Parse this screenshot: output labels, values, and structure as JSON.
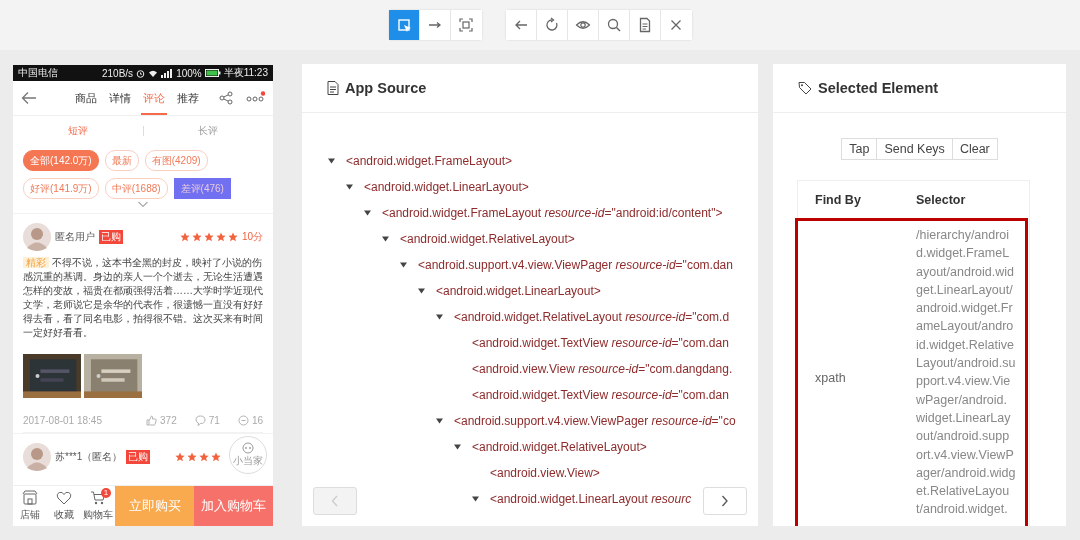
{
  "toolbar": {
    "groups": [
      {
        "tools": [
          {
            "kind": "select",
            "selected": true
          },
          {
            "kind": "swipe",
            "selected": false
          },
          {
            "kind": "area",
            "selected": false
          }
        ]
      },
      {
        "tools": [
          {
            "kind": "back",
            "selected": false
          },
          {
            "kind": "refresh",
            "selected": false
          },
          {
            "kind": "eye",
            "selected": false
          },
          {
            "kind": "search",
            "selected": false
          },
          {
            "kind": "document",
            "selected": false
          },
          {
            "kind": "close",
            "selected": false
          }
        ]
      }
    ]
  },
  "phone": {
    "status_bar": {
      "carrier": "中国电信",
      "speed": "210B/s",
      "battery": "100%",
      "time": "半夜11:23"
    },
    "tabs": [
      {
        "label": "商品",
        "selected": false
      },
      {
        "label": "详情",
        "selected": false
      },
      {
        "label": "评论",
        "selected": true
      },
      {
        "label": "推荐",
        "selected": false
      }
    ],
    "has_notification": true,
    "subtabs": [
      {
        "label": "短评",
        "selected": true
      },
      {
        "label": "长评",
        "selected": false
      }
    ],
    "filters": [
      {
        "label": "全部(142.0万)",
        "selected": true,
        "highlighted": false
      },
      {
        "label": "最新",
        "selected": false,
        "highlighted": false
      },
      {
        "label": "有图(4209)",
        "selected": false,
        "highlighted": false
      },
      {
        "label": "好评(141.9万)",
        "selected": false,
        "highlighted": false
      },
      {
        "label": "中评(1688)",
        "selected": false,
        "highlighted": false
      },
      {
        "label": "差评(476)",
        "selected": false,
        "highlighted": true
      }
    ],
    "reviews": [
      {
        "user": "匿名用户",
        "badge": "已购",
        "stars": 5,
        "score": "10分",
        "tag": "精彩",
        "text": "不得不说，这本书全黑的封皮，映衬了小说的伤感沉重的基调。身边的亲人一个个逝去，无论生活遭遇怎样的变故，福贵在都顽强得活着……大学时学近现代文学，老师说它是余华的代表作，很遗憾一直没有好好得去看，看了同名电影，拍得很不错。这次买来有时间一定好好看看。",
        "photos": [
          {
            "kind": "picture"
          },
          {
            "kind": "picture"
          }
        ],
        "date": "2017-08-01 18:45",
        "likes": "372",
        "comments": "71",
        "replies": "16"
      },
      {
        "user": "苏***1（匿名）",
        "badge": "已购",
        "stars": 4
      }
    ],
    "float_button": {
      "label": "小当家"
    },
    "bottom_bar": {
      "items": [
        {
          "kind": "shop",
          "label": "店铺"
        },
        {
          "kind": "heart",
          "label": "收藏"
        },
        {
          "kind": "cart",
          "label": "购物车",
          "badge": "1"
        }
      ],
      "buttons": [
        {
          "kind": "buy",
          "label": "立即购买"
        },
        {
          "kind": "add",
          "label": "加入购物车"
        }
      ]
    }
  },
  "app_source": {
    "title": "App Source",
    "tree": [
      {
        "text": "<android.widget.FrameLayout>",
        "expanded": true,
        "children": [
          {
            "text": "<android.widget.LinearLayout>",
            "expanded": true,
            "children": [
              {
                "text": "<android.widget.FrameLayout *resource-id*=\"android:id/content\">",
                "expanded": true,
                "children": [
                  {
                    "text": "<android.widget.RelativeLayout>",
                    "expanded": true,
                    "children": [
                      {
                        "text": "<android.support.v4.view.ViewPager *resource-id*=\"com.dan",
                        "expanded": true,
                        "children": [
                          {
                            "text": "<android.widget.LinearLayout>",
                            "expanded": true,
                            "children": [
                              {
                                "text": "<android.widget.RelativeLayout *resource-id*=\"com.d",
                                "expanded": true,
                                "children": [
                                  {
                                    "text": "<android.widget.TextView *resource-id*=\"com.dan"
                                  },
                                  {
                                    "text": "<android.view.View *resource-id*=\"com.dangdang."
                                  },
                                  {
                                    "text": "<android.widget.TextView *resource-id*=\"com.dan"
                                  }
                                ]
                              },
                              {
                                "text": "<android.support.v4.view.ViewPager *resource-id*=\"co",
                                "expanded": true,
                                "children": [
                                  {
                                    "text": "<android.widget.RelativeLayout>",
                                    "expanded": true,
                                    "children": [
                                      {
                                        "text": "<android.view.View>"
                                      },
                                      {
                                        "text": "<android.widget.LinearLayout *resourc*",
                                        "expanded": true
                                      }
                                    ]
                                  }
                                ]
                              }
                            ]
                          }
                        ]
                      }
                    ]
                  }
                ]
              }
            ]
          }
        ]
      }
    ],
    "pager": {
      "prev": {
        "disabled": true
      },
      "next": {
        "disabled": false
      }
    }
  },
  "selected_element": {
    "title": "Selected Element",
    "actions": [
      "Tap",
      "Send Keys",
      "Clear"
    ],
    "table": {
      "columns": [
        "Find By",
        "Selector"
      ],
      "rows": [
        {
          "find_by": "xpath",
          "selector": "/hierarchy/android.widget.FrameLayout/android.widget.LinearLayout/android.widget.FrameLayout/android.widget.RelativeLayout/android.support.v4.view.ViewPager/android.widget.LinearLayout/android.support.v4.view.ViewPager/android.widget.RelativeLayout/android.widget.",
          "highlighted": true
        }
      ]
    }
  }
}
